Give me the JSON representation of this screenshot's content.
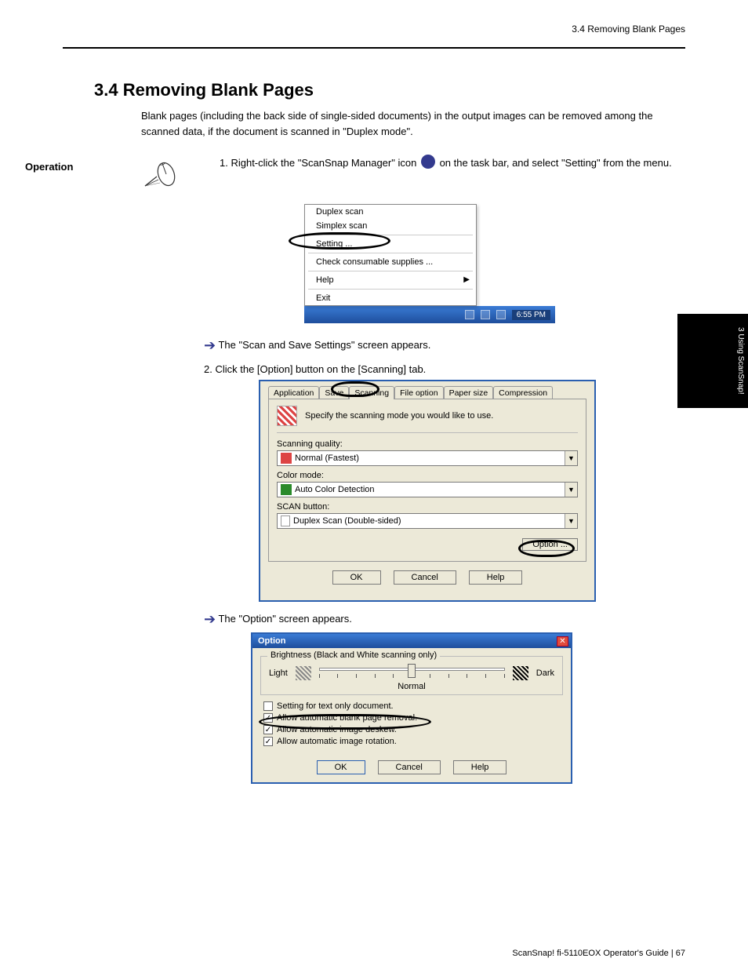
{
  "header": {
    "running_head": "3.4 Removing Blank Pages"
  },
  "title": "3.4 Removing Blank Pages",
  "intro": "Blank pages (including the back side of single-sided documents) in the output images can be removed among the scanned data, if the document is scanned in \"Duplex mode\".",
  "op": {
    "label": "Operation",
    "lead": "1. Right-click the \"ScanSnap Manager\" icon",
    "lead_tail": "on the task bar, and select \"Setting\" from the menu."
  },
  "ctx_menu": {
    "items": [
      "Duplex scan",
      "Simplex scan",
      "Setting ...",
      "Check consumable supplies ...",
      "Help",
      "Exit"
    ],
    "taskbar_time": "6:55 PM"
  },
  "result_1": "The \"Scan and Save Settings\" screen appears.",
  "step2": "2. Click the [Option] button on the [Scanning] tab.",
  "dialog": {
    "tabs": [
      "Application",
      "Save",
      "Scanning",
      "File option",
      "Paper size",
      "Compression"
    ],
    "desc": "Specify the scanning mode you would like to use.",
    "scanning_quality_label": "Scanning quality:",
    "scanning_quality_value": "Normal (Fastest)",
    "color_mode_label": "Color mode:",
    "color_mode_value": "Auto Color Detection",
    "scan_button_label": "SCAN button:",
    "scan_button_value": "Duplex Scan (Double-sided)",
    "option_btn": "Option ...",
    "ok": "OK",
    "cancel": "Cancel",
    "help": "Help"
  },
  "result_2": "The \"Option\" screen appears.",
  "dialog2": {
    "title": "Option",
    "group_title": "Brightness (Black and White scanning only)",
    "light": "Light",
    "dark": "Dark",
    "normal": "Normal",
    "chk_textonly": "Setting for text only document.",
    "chk_blank": "Allow automatic blank page removal.",
    "chk_deskew": "Allow automatic image deskew.",
    "chk_rotate": "Allow automatic image rotation.",
    "ok": "OK",
    "cancel": "Cancel",
    "help": "Help"
  },
  "side_tab": "3 Using ScanSnap!",
  "footer": {
    "label": "ScanSnap! fi-5110EOX Operator's Guide",
    "sep": " | ",
    "page": "67"
  }
}
